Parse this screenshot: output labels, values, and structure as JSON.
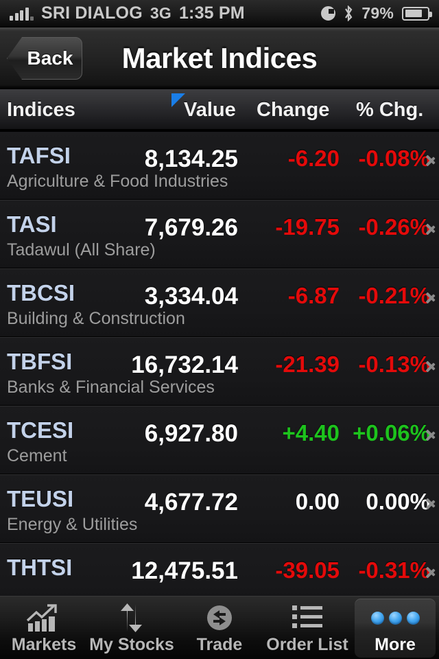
{
  "statusbar": {
    "carrier": "SRI DIALOG",
    "network": "3G",
    "time": "1:35 PM",
    "battery_pct": "79%",
    "signal_icon": "signal-bars-icon",
    "clock_icon": "clock-icon",
    "bluetooth_icon": "bluetooth-icon",
    "battery_icon": "battery-icon"
  },
  "navbar": {
    "back_label": "Back",
    "title": "Market Indices"
  },
  "columns": {
    "indices": "Indices",
    "value": "Value",
    "change": "Change",
    "pct_change": "% Chg.",
    "sort_indicator": "sort-triangle-icon",
    "sort_color": "#1a7ee8"
  },
  "colors": {
    "up": "#1dc31d",
    "down": "#e40a0a",
    "flat": "#ffffff",
    "symbol": "#c3d2ea",
    "subtitle": "#9d9d9d"
  },
  "rows": [
    {
      "symbol": "TAFSI",
      "name": "Agriculture & Food Industries",
      "value": "8,134.25",
      "change": "-6.20",
      "pct": "-0.08%",
      "dir": "down"
    },
    {
      "symbol": "TASI",
      "name": "Tadawul (All Share)",
      "value": "7,679.26",
      "change": "-19.75",
      "pct": "-0.26%",
      "dir": "down"
    },
    {
      "symbol": "TBCSI",
      "name": "Building & Construction",
      "value": "3,334.04",
      "change": "-6.87",
      "pct": "-0.21%",
      "dir": "down"
    },
    {
      "symbol": "TBFSI",
      "name": "Banks & Financial Services",
      "value": "16,732.14",
      "change": "-21.39",
      "pct": "-0.13%",
      "dir": "down"
    },
    {
      "symbol": "TCESI",
      "name": "Cement",
      "value": "6,927.80",
      "change": "+4.40",
      "pct": "+0.06%",
      "dir": "up"
    },
    {
      "symbol": "TEUSI",
      "name": "Energy & Utilities",
      "value": "4,677.72",
      "change": "0.00",
      "pct": "0.00%",
      "dir": "flat"
    },
    {
      "symbol": "THTSI",
      "name": "",
      "value": "12,475.51",
      "change": "-39.05",
      "pct": "-0.31%",
      "dir": "down"
    }
  ],
  "tabs": [
    {
      "label": "Markets",
      "icon": "chart-growth-icon",
      "active": false
    },
    {
      "label": "My Stocks",
      "icon": "up-down-arrows-icon",
      "active": false
    },
    {
      "label": "Trade",
      "icon": "exchange-arrows-icon",
      "active": false
    },
    {
      "label": "Order List",
      "icon": "list-icon",
      "active": false
    },
    {
      "label": "More",
      "icon": "three-dots-icon",
      "active": true
    }
  ]
}
